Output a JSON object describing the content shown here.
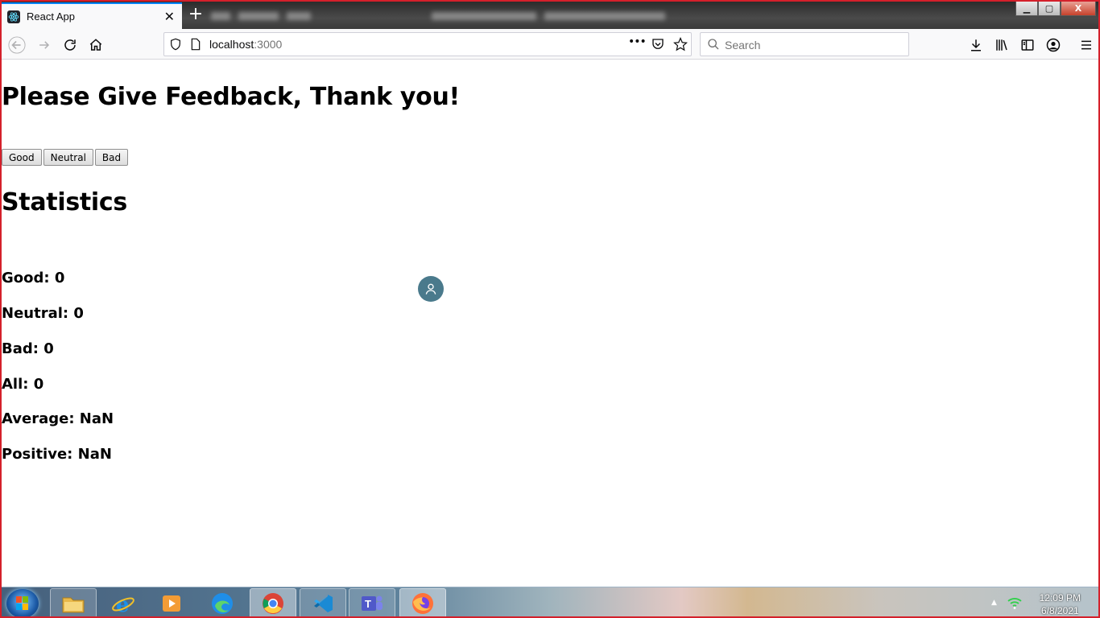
{
  "browser": {
    "tab": {
      "title": "React App",
      "close_glyph": "✕"
    },
    "new_tab_glyph": "+",
    "window_controls": {
      "minimize": "▁",
      "maximize": "▢",
      "close": "X"
    },
    "url": {
      "host": "localhost",
      "port": ":3000"
    },
    "search": {
      "placeholder": "Search"
    },
    "page_actions_glyph": "•••"
  },
  "page": {
    "heading": "Please Give Feedback, Thank you!",
    "buttons": {
      "good": "Good",
      "neutral": "Neutral",
      "bad": "Bad"
    },
    "statistics_heading": "Statistics",
    "stats": {
      "good": "Good: 0",
      "neutral": "Neutral: 0",
      "bad": "Bad: 0",
      "all": "All: 0",
      "average": "Average: NaN",
      "positive": "Positive: NaN"
    }
  },
  "taskbar": {
    "apps": [
      "file-explorer-icon",
      "internet-explorer-icon",
      "media-player-icon",
      "edge-icon",
      "chrome-icon",
      "vscode-icon",
      "teams-icon",
      "firefox-icon"
    ],
    "tray_arrow": "▲",
    "clock": {
      "time": "12:09 PM",
      "date": "6/8/2021"
    }
  },
  "colors": {
    "frame_border": "#d4202b",
    "tab_accent": "#0a84ff",
    "avatar_bg": "#4a7a8c"
  }
}
